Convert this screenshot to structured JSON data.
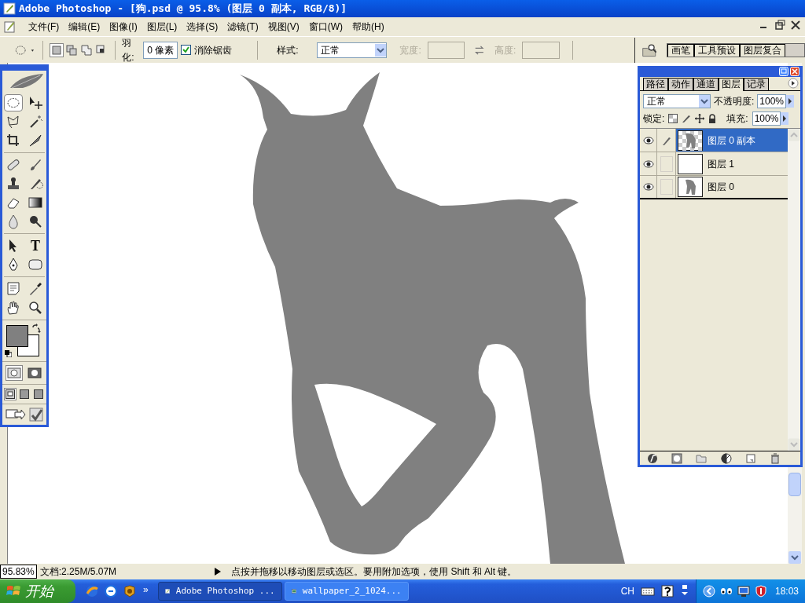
{
  "window": {
    "title": "Adobe Photoshop - [狗.psd @ 95.8% (图层 0 副本, RGB/8)]"
  },
  "menu": [
    "文件(F)",
    "编辑(E)",
    "图像(I)",
    "图层(L)",
    "选择(S)",
    "滤镜(T)",
    "视图(V)",
    "窗口(W)",
    "帮助(H)"
  ],
  "options_bar": {
    "selection_modes": [
      {
        "selected": true
      },
      {
        "selected": false
      },
      {
        "selected": false
      },
      {
        "selected": false
      }
    ],
    "feather_label": "羽化:",
    "feather_value": "0 像素",
    "antialias": {
      "label": "消除锯齿",
      "checked": true
    },
    "style_label": "样式:",
    "style_value": "正常",
    "width_label": "宽度:",
    "height_label": "高度:"
  },
  "palette_well": [
    {
      "label": "画笔"
    },
    {
      "label": "工具预设"
    },
    {
      "label": "图层复合"
    }
  ],
  "toolbox": {
    "tools": [
      {
        "selected": true
      },
      {
        "selected": false
      },
      {
        "selected": false
      },
      {
        "selected": false
      },
      {
        "selected": false
      },
      {
        "selected": false
      },
      {
        "selected": false
      },
      {
        "selected": false
      },
      {
        "selected": false
      },
      {
        "selected": false
      },
      {
        "selected": false
      },
      {
        "selected": false
      },
      {
        "selected": false
      },
      {
        "selected": false
      },
      {
        "selected": false
      },
      {
        "selected": false,
        "glyph": "T"
      },
      {
        "selected": false
      },
      {
        "selected": false
      },
      {
        "selected": false
      },
      {
        "selected": false
      },
      {
        "selected": false
      },
      {
        "selected": false
      }
    ],
    "modes": [
      {
        "selected": true
      },
      {
        "selected": false
      }
    ],
    "screen_modes": [
      {
        "selected": true
      },
      {
        "selected": false
      },
      {
        "selected": false
      }
    ]
  },
  "layers_panel": {
    "tabs": [
      {
        "label": "路径",
        "selected": false
      },
      {
        "label": "动作",
        "selected": false
      },
      {
        "label": "通道",
        "selected": false
      },
      {
        "label": "图层",
        "selected": true
      },
      {
        "label": "记录",
        "selected": false
      }
    ],
    "blend_mode": "正常",
    "opacity_label": "不透明度:",
    "opacity": "100%",
    "lock_label": "锁定:",
    "fill_label": "填充:",
    "fill": "100%",
    "layers": [
      {
        "name": "图层 0 副本",
        "visible": true,
        "selected": true,
        "kind": "transparent_dog"
      },
      {
        "name": "图层 1",
        "visible": true,
        "selected": false,
        "kind": "white"
      },
      {
        "name": "图层 0",
        "visible": true,
        "selected": false,
        "kind": "dog"
      }
    ]
  },
  "status_bar": {
    "zoom": "95.83%",
    "doc_size": "文档:2.25M/5.07M",
    "hint": "点按并拖移以移动图层或选区。要用附加选项，使用 Shift 和 Alt 键。"
  },
  "taskbar": {
    "start": "开始",
    "chevron": "»",
    "tasks": [
      {
        "label": "Adobe Photoshop ...",
        "selected": true
      },
      {
        "label": "wallpaper_2_1024...",
        "selected": false
      }
    ],
    "language": "CH",
    "clock": "18:03"
  }
}
